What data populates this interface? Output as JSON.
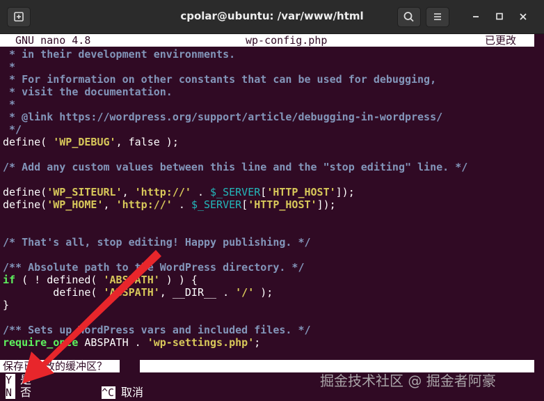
{
  "window": {
    "title": "cpolar@ubuntu: /var/www/html"
  },
  "nano": {
    "version": "GNU nano 4.8",
    "filename": "wp-config.php",
    "status": "已更改"
  },
  "code_lines": [
    [
      {
        "c": "c",
        "t": " * in their development environments."
      }
    ],
    [
      {
        "c": "c",
        "t": " *"
      }
    ],
    [
      {
        "c": "c",
        "t": " * For information on other constants that can be used for debugging,"
      }
    ],
    [
      {
        "c": "c",
        "t": " * visit the documentation."
      }
    ],
    [
      {
        "c": "c",
        "t": " *"
      }
    ],
    [
      {
        "c": "c",
        "t": " * @link https://wordpress.org/support/article/debugging-in-wordpress/"
      }
    ],
    [
      {
        "c": "c",
        "t": " */"
      }
    ],
    [
      {
        "c": "p",
        "t": "define( "
      },
      {
        "c": "s",
        "t": "'WP_DEBUG'"
      },
      {
        "c": "p",
        "t": ", false );"
      }
    ],
    [
      {
        "c": "p",
        "t": ""
      }
    ],
    [
      {
        "c": "c",
        "t": "/* Add any custom values between this line and the \"stop editing\" line. */"
      }
    ],
    [
      {
        "c": "p",
        "t": ""
      }
    ],
    [
      {
        "c": "p",
        "t": "define("
      },
      {
        "c": "s",
        "t": "'WP_SITEURL'"
      },
      {
        "c": "p",
        "t": ", "
      },
      {
        "c": "s",
        "t": "'http://'"
      },
      {
        "c": "p",
        "t": " . "
      },
      {
        "c": "t",
        "t": "$_SERVER"
      },
      {
        "c": "p",
        "t": "["
      },
      {
        "c": "s",
        "t": "'HTTP_HOST'"
      },
      {
        "c": "p",
        "t": "]);"
      }
    ],
    [
      {
        "c": "p",
        "t": "define("
      },
      {
        "c": "s",
        "t": "'WP_HOME'"
      },
      {
        "c": "p",
        "t": ", "
      },
      {
        "c": "s",
        "t": "'http://'"
      },
      {
        "c": "p",
        "t": " . "
      },
      {
        "c": "t",
        "t": "$_SERVER"
      },
      {
        "c": "p",
        "t": "["
      },
      {
        "c": "s",
        "t": "'HTTP_HOST'"
      },
      {
        "c": "p",
        "t": "]);"
      }
    ],
    [
      {
        "c": "p",
        "t": ""
      }
    ],
    [
      {
        "c": "p",
        "t": ""
      }
    ],
    [
      {
        "c": "c",
        "t": "/* That's all, stop editing! Happy publishing. */"
      }
    ],
    [
      {
        "c": "p",
        "t": ""
      }
    ],
    [
      {
        "c": "c",
        "t": "/** Absolute path to the WordPress directory. */"
      }
    ],
    [
      {
        "c": "k",
        "t": "if"
      },
      {
        "c": "p",
        "t": " ( ! defined( "
      },
      {
        "c": "s",
        "t": "'ABSPATH'"
      },
      {
        "c": "p",
        "t": " ) ) {"
      }
    ],
    [
      {
        "c": "p",
        "t": "        define( "
      },
      {
        "c": "s",
        "t": "'ABSPATH'"
      },
      {
        "c": "p",
        "t": ", __DIR__ . "
      },
      {
        "c": "s",
        "t": "'/'"
      },
      {
        "c": "p",
        "t": " );"
      }
    ],
    [
      {
        "c": "p",
        "t": "}"
      }
    ],
    [
      {
        "c": "p",
        "t": ""
      }
    ],
    [
      {
        "c": "c",
        "t": "/** Sets up WordPress vars and included files. */"
      }
    ],
    [
      {
        "c": "k",
        "t": "require_once"
      },
      {
        "c": "p",
        "t": " ABSPATH . "
      },
      {
        "c": "s",
        "t": "'wp-settings.php'"
      },
      {
        "c": "p",
        "t": ";"
      }
    ]
  ],
  "prompt": {
    "question": "保存已修改的缓冲区？"
  },
  "options": {
    "yes_key": "Y",
    "yes_label": "是",
    "no_key": "N",
    "no_label": "否",
    "cancel_key": "^C",
    "cancel_label": "取消"
  },
  "watermark": "掘金技术社区 @ 掘金者阿豪",
  "icons": [
    "new-tab-icon",
    "search-icon",
    "hamburger-menu-icon",
    "minimize-icon",
    "maximize-icon",
    "close-icon",
    "annotation-arrow"
  ],
  "colors": {
    "terminal_bg": "#300a24",
    "comment": "#8396ba",
    "string": "#d8c85a",
    "keyword": "#5ef25e",
    "variable": "#23b7ba",
    "arrow": "#e8262b"
  }
}
